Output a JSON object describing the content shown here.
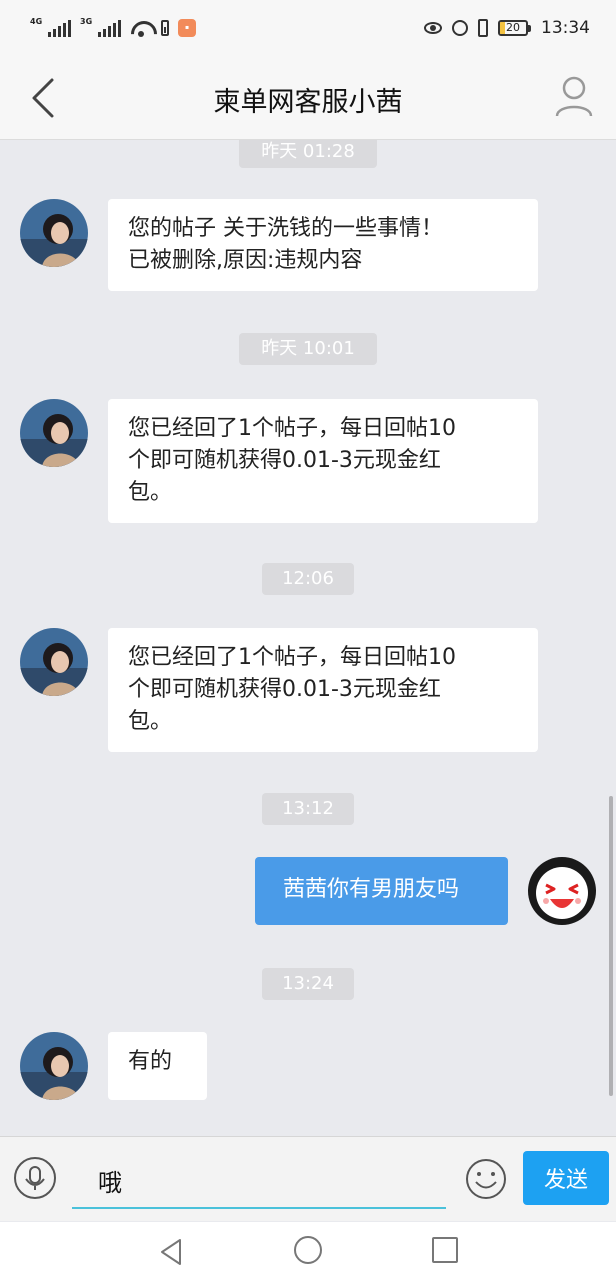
{
  "status_bar": {
    "network1": "4G",
    "network2": "3G",
    "battery_level": "20",
    "time": "13:34"
  },
  "header": {
    "title": "柬单网客服小茜"
  },
  "messages": [
    {
      "timestamp": "昨天 01:28",
      "from": "agent",
      "text": "您的帖子 关于洗钱的一些事情！\n已被删除,原因:违规内容"
    },
    {
      "timestamp": "昨天 10:01",
      "from": "agent",
      "text": "您已经回了1个帖子，每日回帖10\n个即可随机获得0.01-3元现金红\n包。"
    },
    {
      "timestamp": "12:06",
      "from": "agent",
      "text": "您已经回了1个帖子，每日回帖10\n个即可随机获得0.01-3元现金红\n包。"
    },
    {
      "timestamp": "13:12",
      "from": "me",
      "text": "茜茜你有男朋友吗"
    },
    {
      "timestamp": "13:24",
      "from": "agent",
      "text": "有的"
    }
  ],
  "input": {
    "value": "哦",
    "send_label": "发送"
  },
  "colors": {
    "chat_bg": "#e9eaee",
    "outgoing_bubble": "#4a9be8",
    "send_button": "#1da1f2",
    "input_underline": "#4ac1da"
  },
  "icons": {
    "back": "chevron-left-icon",
    "profile": "user-icon",
    "mic": "microphone-icon",
    "emoji": "smiley-icon"
  }
}
